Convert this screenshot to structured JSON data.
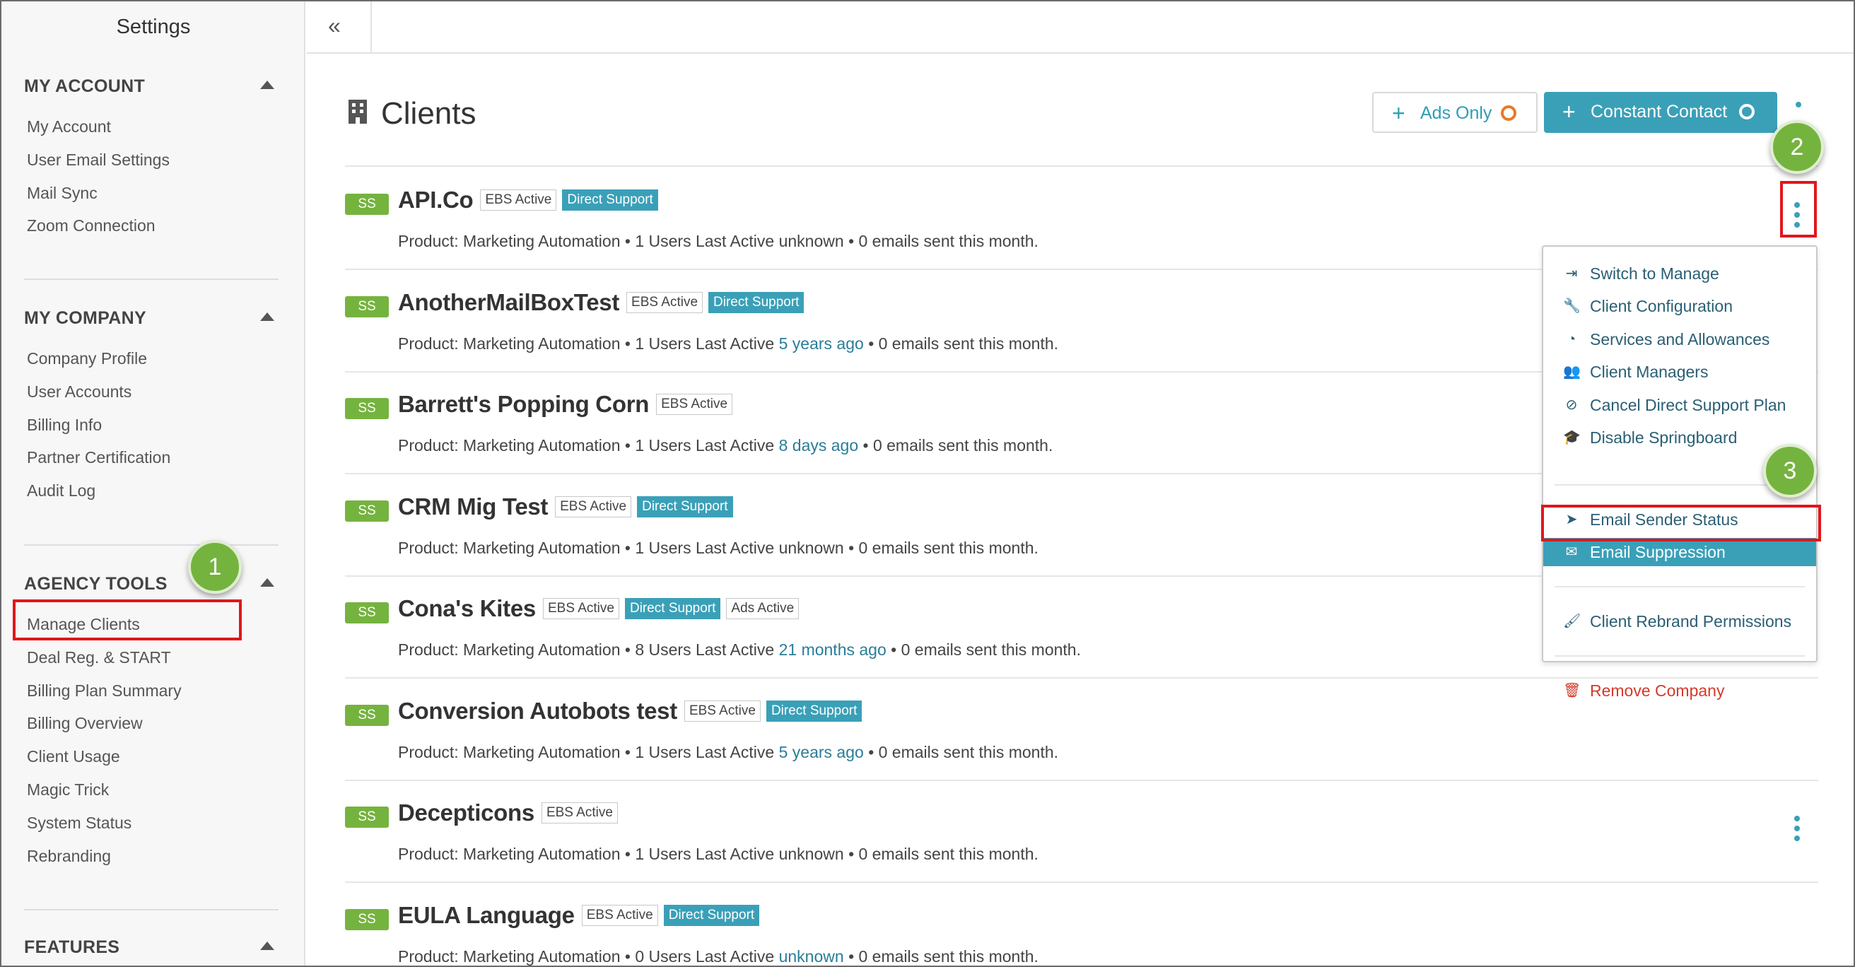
{
  "sidebar": {
    "title": "Settings",
    "sections": [
      {
        "header": "MY ACCOUNT",
        "items": [
          "My Account",
          "User Email Settings",
          "Mail Sync",
          "Zoom Connection"
        ]
      },
      {
        "header": "MY COMPANY",
        "items": [
          "Company Profile",
          "User Accounts",
          "Billing Info",
          "Partner Certification",
          "Audit Log"
        ]
      },
      {
        "header": "AGENCY TOOLS",
        "items": [
          "Manage Clients",
          "Deal Reg. & START",
          "Billing Plan Summary",
          "Billing Overview",
          "Client Usage",
          "Magic Trick",
          "System Status",
          "Rebranding"
        ]
      },
      {
        "header": "FEATURES",
        "items": []
      }
    ]
  },
  "callouts": [
    "1",
    "2",
    "3"
  ],
  "header": {
    "title": "Clients",
    "buttons": {
      "ads_only": "Ads Only",
      "constant_contact": "Constant Contact"
    }
  },
  "colors": {
    "accent": "#3aa0b8",
    "badge_green": "#75b33f",
    "highlight_red": "#e0171b",
    "danger": "#d43a2a"
  },
  "clients": [
    {
      "badge": "SS",
      "name": "API.Co",
      "tags": [
        {
          "type": "ebs",
          "text": "EBS Active"
        },
        {
          "type": "direct",
          "text": "Direct Support"
        }
      ],
      "detail_pre": "Product: Marketing Automation • 1 Users Last Active",
      "last_active": "unknown",
      "last_active_is_link": false,
      "detail_post": "• 0 emails sent this month."
    },
    {
      "badge": "SS",
      "name": "AnotherMailBoxTest",
      "tags": [
        {
          "type": "ebs",
          "text": "EBS Active"
        },
        {
          "type": "direct",
          "text": "Direct Support"
        }
      ],
      "detail_pre": "Product: Marketing Automation • 1 Users Last Active",
      "last_active": "5 years ago",
      "last_active_is_link": true,
      "detail_post": "• 0 emails sent this month."
    },
    {
      "badge": "SS",
      "name": "Barrett's Popping Corn",
      "tags": [
        {
          "type": "ebs",
          "text": "EBS Active"
        }
      ],
      "detail_pre": "Product: Marketing Automation • 1 Users Last Active",
      "last_active": "8 days ago",
      "last_active_is_link": true,
      "detail_post": "• 0 emails sent this month."
    },
    {
      "badge": "SS",
      "name": "CRM Mig Test",
      "tags": [
        {
          "type": "ebs",
          "text": "EBS Active"
        },
        {
          "type": "direct",
          "text": "Direct Support"
        }
      ],
      "detail_pre": "Product: Marketing Automation • 1 Users Last Active",
      "last_active": "unknown",
      "last_active_is_link": false,
      "detail_post": "• 0 emails sent this month."
    },
    {
      "badge": "SS",
      "name": "Cona's Kites",
      "tags": [
        {
          "type": "ebs",
          "text": "EBS Active"
        },
        {
          "type": "direct",
          "text": "Direct Support"
        },
        {
          "type": "ads",
          "text": "Ads Active"
        }
      ],
      "detail_pre": "Product: Marketing Automation • 8 Users Last Active",
      "last_active": "21 months ago",
      "last_active_is_link": true,
      "detail_post": "• 0 emails sent this month."
    },
    {
      "badge": "SS",
      "name": "Conversion Autobots test",
      "tags": [
        {
          "type": "ebs",
          "text": "EBS Active"
        },
        {
          "type": "direct",
          "text": "Direct Support"
        }
      ],
      "detail_pre": "Product: Marketing Automation • 1 Users Last Active",
      "last_active": "5 years ago",
      "last_active_is_link": true,
      "detail_post": "• 0 emails sent this month."
    },
    {
      "badge": "SS",
      "name": "Decepticons",
      "tags": [
        {
          "type": "ebs",
          "text": "EBS Active"
        }
      ],
      "detail_pre": "Product: Marketing Automation • 1 Users Last Active",
      "last_active": "unknown",
      "last_active_is_link": false,
      "detail_post": "• 0 emails sent this month."
    },
    {
      "badge": "SS",
      "name": "EULA Language",
      "tags": [
        {
          "type": "ebs",
          "text": "EBS Active"
        },
        {
          "type": "direct",
          "text": "Direct Support"
        }
      ],
      "detail_pre": "Product: Marketing Automation • 0 Users Last Active",
      "last_active": "unknown",
      "last_active_is_link": true,
      "detail_post": "• 0 emails sent this month."
    }
  ],
  "dropdown": {
    "groups": [
      [
        {
          "label": "Switch to Manage",
          "icon": "switch-icon"
        },
        {
          "label": "Client Configuration",
          "icon": "wrench-icon"
        },
        {
          "label": "Services and Allowances",
          "icon": "dashboard-icon"
        },
        {
          "label": "Client Managers",
          "icon": "users-icon"
        },
        {
          "label": "Cancel Direct Support Plan",
          "icon": "ban-icon"
        },
        {
          "label": "Disable Springboard",
          "icon": "graduation-cap-icon"
        }
      ],
      [
        {
          "label": "Email Sender Status",
          "icon": "paper-plane-icon"
        },
        {
          "label": "Email Suppression",
          "icon": "envelope-icon",
          "active": true
        }
      ],
      [
        {
          "label": "Client Rebrand Permissions",
          "icon": "brush-icon"
        }
      ],
      [
        {
          "label": "Remove Company",
          "icon": "trash-icon",
          "danger": true
        }
      ]
    ]
  }
}
